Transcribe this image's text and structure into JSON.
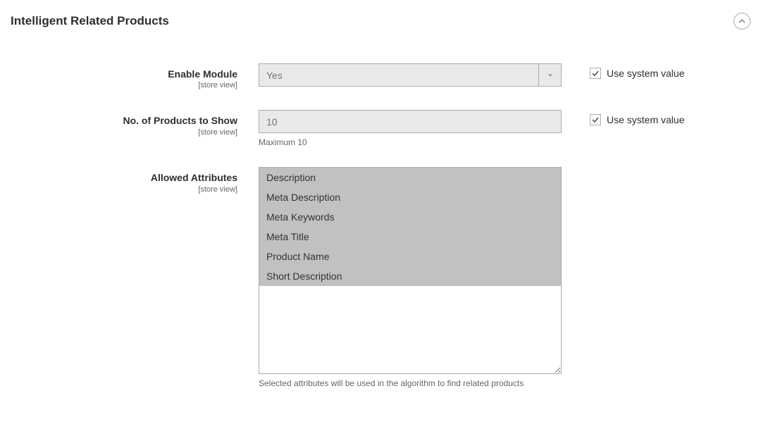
{
  "section": {
    "title": "Intelligent Related Products"
  },
  "fields": {
    "enable_module": {
      "label": "Enable Module",
      "scope": "[store view]",
      "value": "Yes",
      "use_system": "Use system value"
    },
    "products_to_show": {
      "label": "No. of Products to Show",
      "scope": "[store view]",
      "value": "10",
      "helper": "Maximum 10",
      "use_system": "Use system value"
    },
    "allowed_attributes": {
      "label": "Allowed Attributes",
      "scope": "[store view]",
      "options": [
        "Description",
        "Meta Description",
        "Meta Keywords",
        "Meta Title",
        "Product Name",
        "Short Description"
      ],
      "helper": "Selected attributes will be used in the algorithm to find related products"
    }
  }
}
